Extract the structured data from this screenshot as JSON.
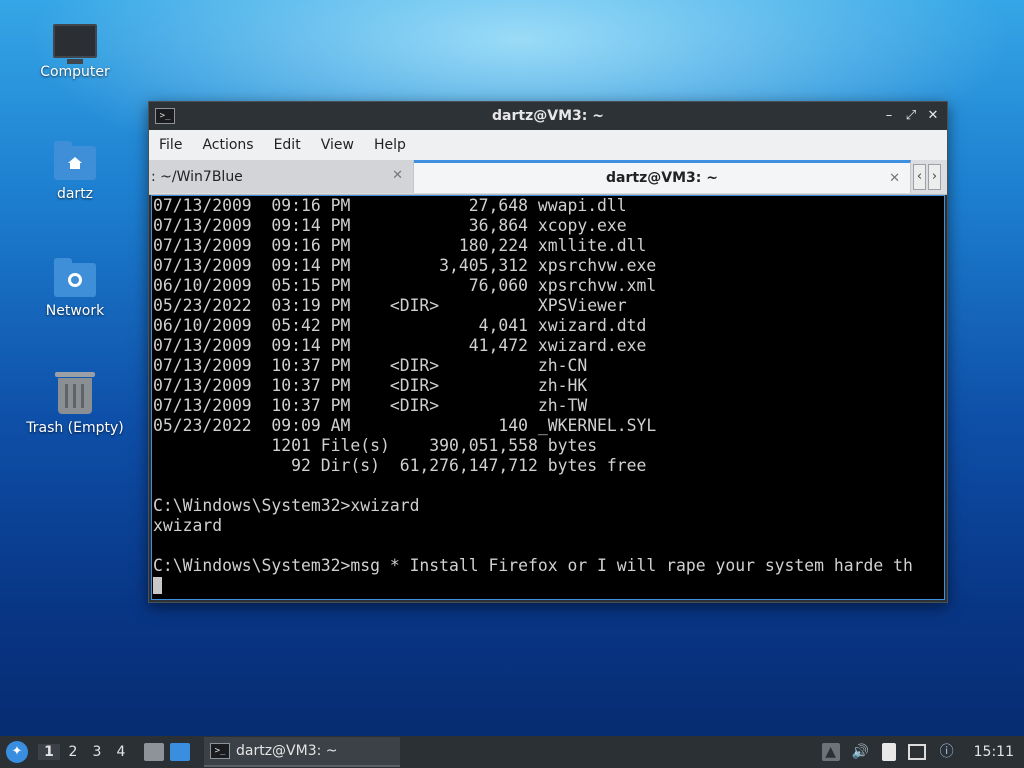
{
  "desktop": {
    "icons": [
      {
        "label": "Computer"
      },
      {
        "label": "dartz"
      },
      {
        "label": "Network"
      },
      {
        "label": "Trash (Empty)"
      }
    ]
  },
  "window": {
    "title": "dartz@VM3: ~",
    "controls": {
      "minimize": "–",
      "maximize": "⤢",
      "close": "✕"
    },
    "menu": [
      "File",
      "Actions",
      "Edit",
      "View",
      "Help"
    ],
    "tabs": [
      {
        "label": ": ~/Win7Blue",
        "close": "✕"
      },
      {
        "label": "dartz@VM3: ~",
        "close": "✕"
      }
    ],
    "tab_nav": {
      "prev": "‹",
      "next": "›"
    }
  },
  "terminal": {
    "lines": [
      "07/13/2009  09:16 PM            27,648 wwapi.dll",
      "07/13/2009  09:14 PM            36,864 xcopy.exe",
      "07/13/2009  09:16 PM           180,224 xmllite.dll",
      "07/13/2009  09:14 PM         3,405,312 xpsrchvw.exe",
      "06/10/2009  05:15 PM            76,060 xpsrchvw.xml",
      "05/23/2022  03:19 PM    <DIR>          XPSViewer",
      "06/10/2009  05:42 PM             4,041 xwizard.dtd",
      "07/13/2009  09:14 PM            41,472 xwizard.exe",
      "07/13/2009  10:37 PM    <DIR>          zh-CN",
      "07/13/2009  10:37 PM    <DIR>          zh-HK",
      "07/13/2009  10:37 PM    <DIR>          zh-TW",
      "05/23/2022  09:09 AM               140 _WKERNEL.SYL",
      "            1201 File(s)    390,051,558 bytes",
      "              92 Dir(s)  61,276,147,712 bytes free",
      "",
      "C:\\Windows\\System32>xwizard",
      "xwizard",
      "",
      "C:\\Windows\\System32>msg * Install Firefox or I will rape your system harde th"
    ]
  },
  "taskbar": {
    "workspaces": [
      "1",
      "2",
      "3",
      "4"
    ],
    "task_label": "dartz@VM3: ~",
    "clock": "15:11"
  }
}
